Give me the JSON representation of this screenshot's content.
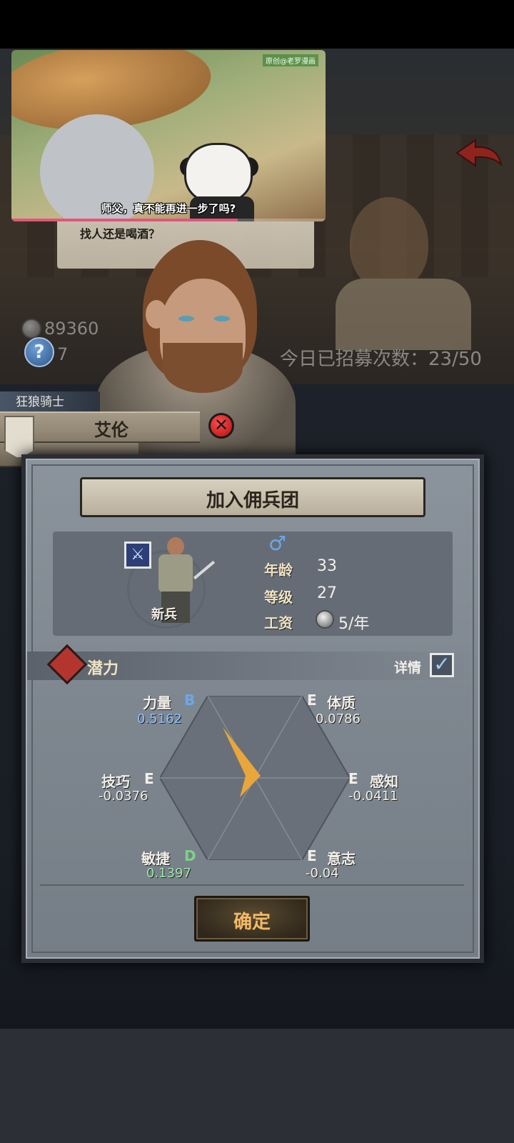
{
  "video": {
    "caption": "师父，真不能再进一步了吗?",
    "watermark": "原创@老罗漫画",
    "progress_fraction": 0.72
  },
  "scene": {
    "speech_text": "找人还是喝酒？",
    "gold_amount": "89360",
    "secondary_count": "7",
    "recruit_count_text": "今日已招募次数：23/50"
  },
  "character": {
    "class_name": "狂狼骑士",
    "name": "艾伦"
  },
  "dialog": {
    "title": "加入佣兵团",
    "rank": "新兵",
    "gender_symbol": "♂",
    "age_label": "年龄",
    "age_value": "33",
    "level_label": "等级",
    "level_value": "27",
    "wage_label": "工资",
    "wage_value": "5/年",
    "potential_label": "潜力",
    "detail_label": "详情",
    "detail_checked": true,
    "confirm_label": "确定"
  },
  "attributes": [
    {
      "name": "力量",
      "grade": "B",
      "value": "0.5162",
      "grade_color": "#6ea6e8",
      "value_color": "#8cc0ff"
    },
    {
      "name": "体质",
      "grade": "E",
      "value": "0.0786",
      "grade_color": "#f2efe9",
      "value_color": "#f2efe9"
    },
    {
      "name": "感知",
      "grade": "E",
      "value": "-0.0411",
      "grade_color": "#f2efe9",
      "value_color": "#f2efe9"
    },
    {
      "name": "意志",
      "grade": "E",
      "value": "-0.04",
      "grade_color": "#f2efe9",
      "value_color": "#f2efe9"
    },
    {
      "name": "敏捷",
      "grade": "D",
      "value": "0.1397",
      "grade_color": "#7cd08a",
      "value_color": "#9ee8a8"
    },
    {
      "name": "技巧",
      "grade": "E",
      "value": "-0.0376",
      "grade_color": "#f2efe9",
      "value_color": "#f2efe9"
    }
  ],
  "colors": {
    "accent_orange": "#e9a63a",
    "confirm_text": "#f2b968",
    "close_red": "#e02a2a"
  }
}
